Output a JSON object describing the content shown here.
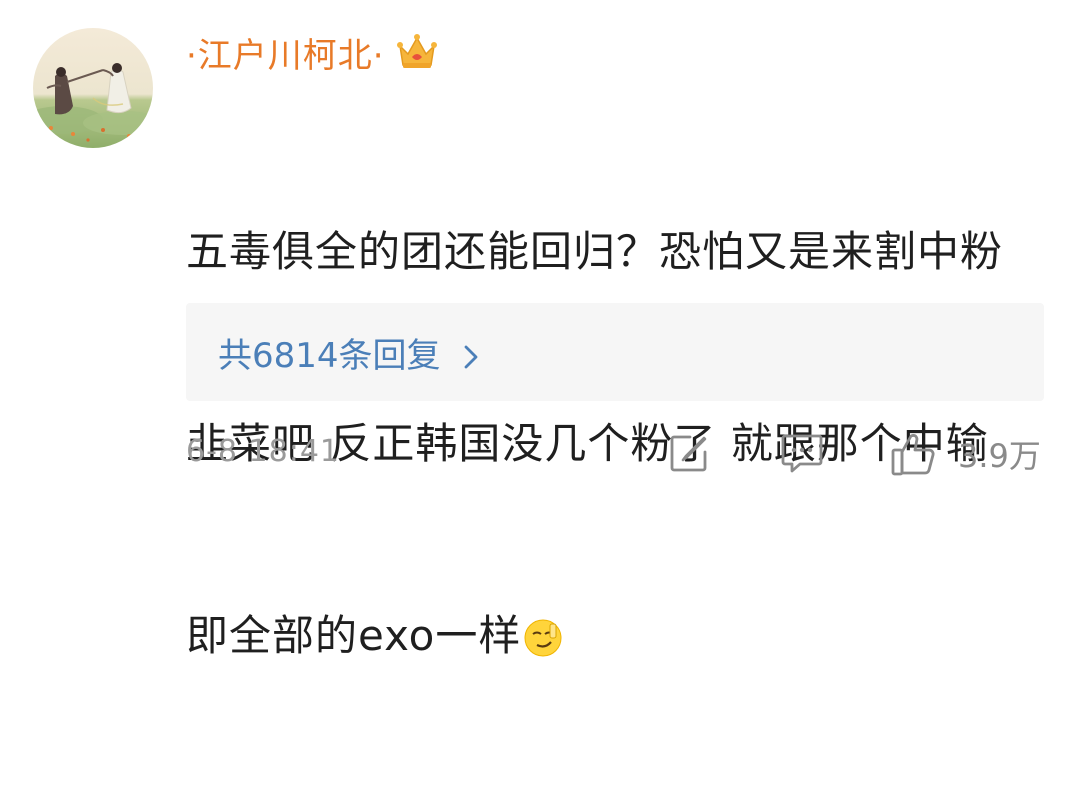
{
  "comment": {
    "username": "·江户川柯北·",
    "badge_icon": "crown-icon",
    "content_lines": [
      "五毒俱全的团还能回归？恐怕又是来割中粉",
      "韭菜吧 反正韩国没几个粉了 就跟那个中输",
      "即全部的exo一样"
    ],
    "content_emoji": "smirk-emoji",
    "replies": {
      "label": "共6814条回复",
      "chevron_icon": "chevron-right-icon"
    },
    "footer": {
      "timestamp": "6-8 18:41",
      "edit_icon": "edit-icon",
      "comment_icon": "comment-icon",
      "like_icon": "thumbs-up-icon",
      "like_count": "3.9万"
    },
    "colors": {
      "username": "#e87a28",
      "link": "#4b7fb8",
      "meta": "#9a9a9a",
      "reply_bg": "#f6f6f6"
    }
  }
}
